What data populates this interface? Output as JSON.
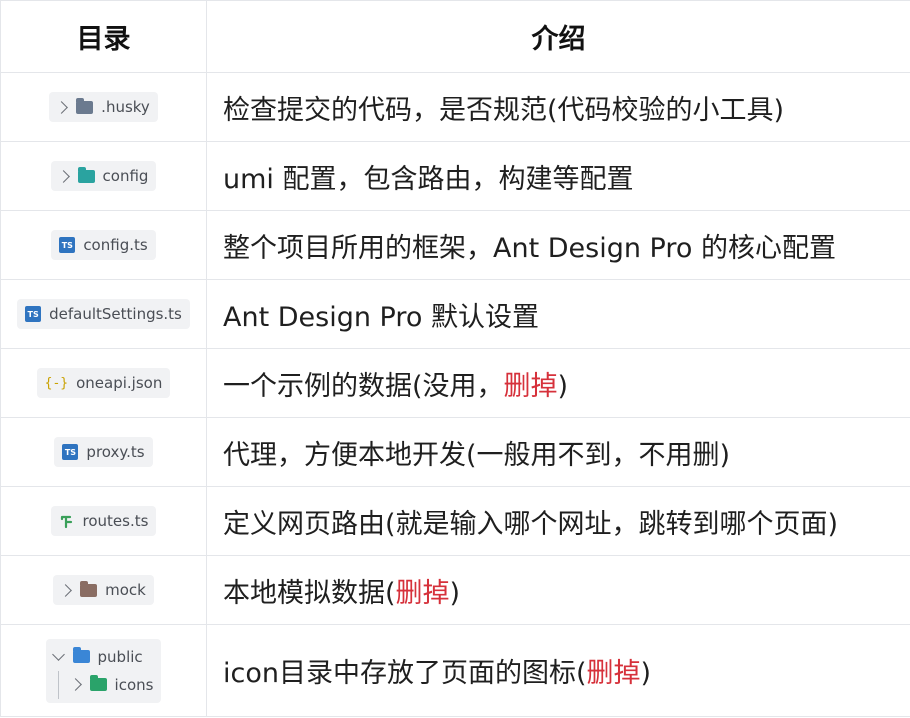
{
  "headers": {
    "dir": "目录",
    "intro": "介绍"
  },
  "rows": [
    {
      "file": ".husky",
      "desc": "检查提交的代码，是否规范(代码校验的小工具)"
    },
    {
      "file": "config",
      "desc": "umi 配置，包含路由，构建等配置"
    },
    {
      "file": "config.ts",
      "desc": "整个项目所用的框架，Ant Design Pro 的核心配置"
    },
    {
      "file": "defaultSettings.ts",
      "desc": "Ant Design Pro 默认设置"
    },
    {
      "file": "oneapi.json",
      "desc_a": "一个示例的数据(没用，",
      "desc_red": "删掉",
      "desc_b": ")"
    },
    {
      "file": "proxy.ts",
      "desc": "代理，方便本地开发(一般用不到，不用删)"
    },
    {
      "file": "routes.ts",
      "desc": "定义网页路由(就是输入哪个网址，跳转到哪个页面)"
    },
    {
      "file": "mock",
      "desc_a": "本地模拟数据(",
      "desc_red": "删掉",
      "desc_b": ")"
    },
    {
      "file": "public",
      "subfile": "icons",
      "desc_a": "icon目录中存放了页面的图标(",
      "desc_red": "删掉",
      "desc_b": ")"
    }
  ],
  "ts_badge": "TS",
  "json_glyph": "{-}",
  "colors": {
    "accent_red": "#d6313b",
    "ts_blue": "#2f74c0",
    "husky_folder": "#6b7a8f",
    "config_folder": "#2aa3a0",
    "mock_folder": "#8a6d63",
    "public_folder": "#3a86d6",
    "icons_folder": "#2aa36a",
    "routes_green": "#3aa05a",
    "json_yellow": "#c9a100"
  }
}
